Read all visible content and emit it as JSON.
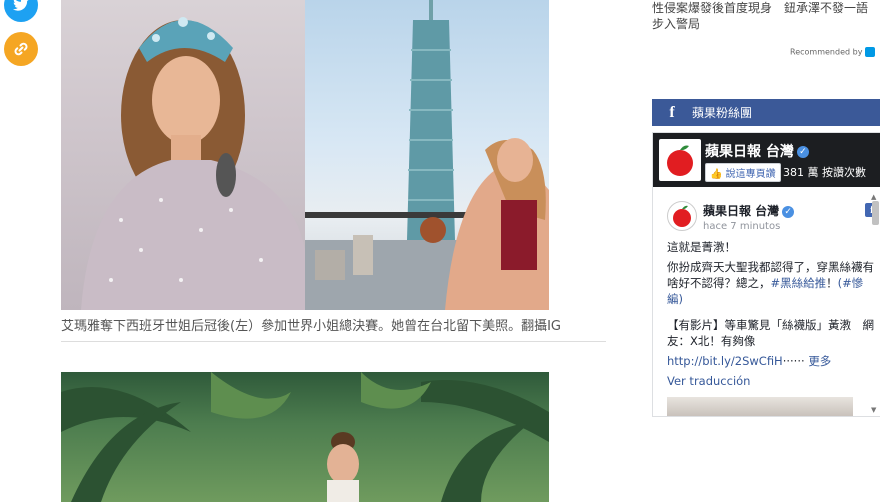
{
  "share": {
    "twitter_icon": "twitter-icon",
    "link_icon": "link-icon"
  },
  "article": {
    "photo1_caption": "艾瑪雅奪下西班牙世姐后冠後(左）參加世界小姐總決賽。她曾在台北留下美照。翻攝IG"
  },
  "related": {
    "line1": "性侵案爆發後首度現身　鈕承澤不發一語",
    "line2": "步入警局",
    "recommended": "Recommended by"
  },
  "fb_widget": {
    "header_label": "蘋果粉絲團",
    "page_name": "蘋果日報 台灣",
    "like_button": "說這專頁讚",
    "likes_text": "381 萬 按讚次數",
    "post": {
      "author": "蘋果日報 台灣",
      "time": "hace 7 minutos",
      "text1": "這就是菁漖！",
      "text2": "你扮成齊天大聖我都認得了，穿黑絲襪有啥好不認得？總之，",
      "hashtag1": "#黑絲給推",
      "text3": "！",
      "hashtag2": "(#慘編)",
      "text4": "【有影片】等車驚見「絲襪版」黃漖　網友：X北！有夠像",
      "link": "http://bit.ly/2SwCfiH",
      "ellipsis": "······",
      "more": "更多",
      "translate": "Ver traducción"
    }
  },
  "colors": {
    "facebook_blue": "#3b5998",
    "twitter_blue": "#1da1f2",
    "link_orange": "#f5a623"
  }
}
